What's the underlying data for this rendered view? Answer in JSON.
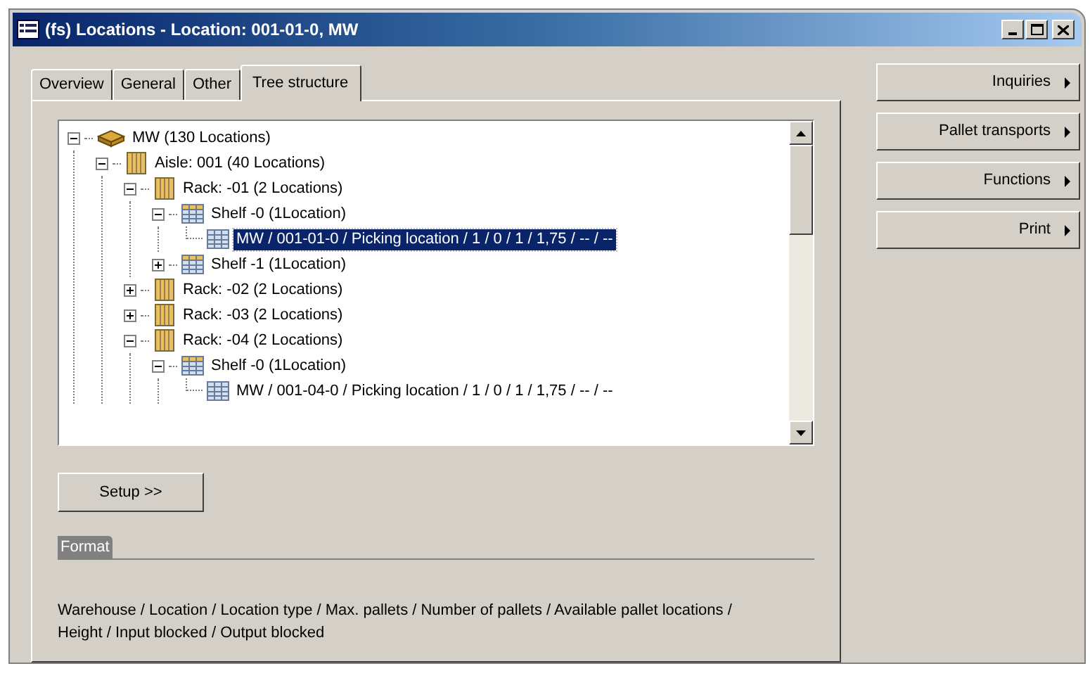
{
  "window": {
    "title": "(fs) Locations - Location: 001-01-0, MW"
  },
  "tabs": [
    {
      "label": "Overview",
      "selected": false
    },
    {
      "label": "General",
      "selected": false
    },
    {
      "label": "Other",
      "selected": false
    },
    {
      "label": "Tree structure",
      "selected": true
    }
  ],
  "tree": [
    {
      "kind": "warehouse",
      "label": "MW (130 Locations)",
      "expanded": true,
      "selected": false,
      "children": [
        {
          "kind": "aisle",
          "label": "Aisle: 001 (40 Locations)",
          "expanded": true,
          "selected": false,
          "children": [
            {
              "kind": "rack",
              "label": "Rack: -01 (2 Locations)",
              "expanded": true,
              "selected": false,
              "children": [
                {
                  "kind": "shelf",
                  "label": "Shelf -0 (1Location)",
                  "expanded": true,
                  "selected": false,
                  "children": [
                    {
                      "kind": "location",
                      "label": "MW / 001-01-0 / Picking location / 1 / 0 / 1 / 1,75 / -- / --",
                      "selected": true
                    }
                  ]
                },
                {
                  "kind": "shelf",
                  "label": "Shelf -1 (1Location)",
                  "expanded": false,
                  "selected": false
                }
              ]
            },
            {
              "kind": "rack",
              "label": "Rack: -02 (2 Locations)",
              "expanded": false,
              "selected": false
            },
            {
              "kind": "rack",
              "label": "Rack: -03 (2 Locations)",
              "expanded": false,
              "selected": false
            },
            {
              "kind": "rack",
              "label": "Rack: -04 (2 Locations)",
              "expanded": true,
              "selected": false,
              "children": [
                {
                  "kind": "shelf",
                  "label": "Shelf -0 (1Location)",
                  "expanded": true,
                  "selected": false,
                  "children": [
                    {
                      "kind": "location",
                      "label": "MW / 001-04-0 / Picking location / 1 / 0 / 1 / 1,75 / -- / --",
                      "selected": false
                    }
                  ]
                }
              ]
            }
          ]
        }
      ]
    }
  ],
  "setup_button": "Setup >>",
  "format": {
    "title": "Format",
    "text": "Warehouse / Location / Location type / Max. pallets / Number of pallets / Available pallet locations / Height / Input blocked / Output blocked"
  },
  "side_buttons": [
    "Inquiries",
    "Pallet transports",
    "Functions",
    "Print"
  ]
}
